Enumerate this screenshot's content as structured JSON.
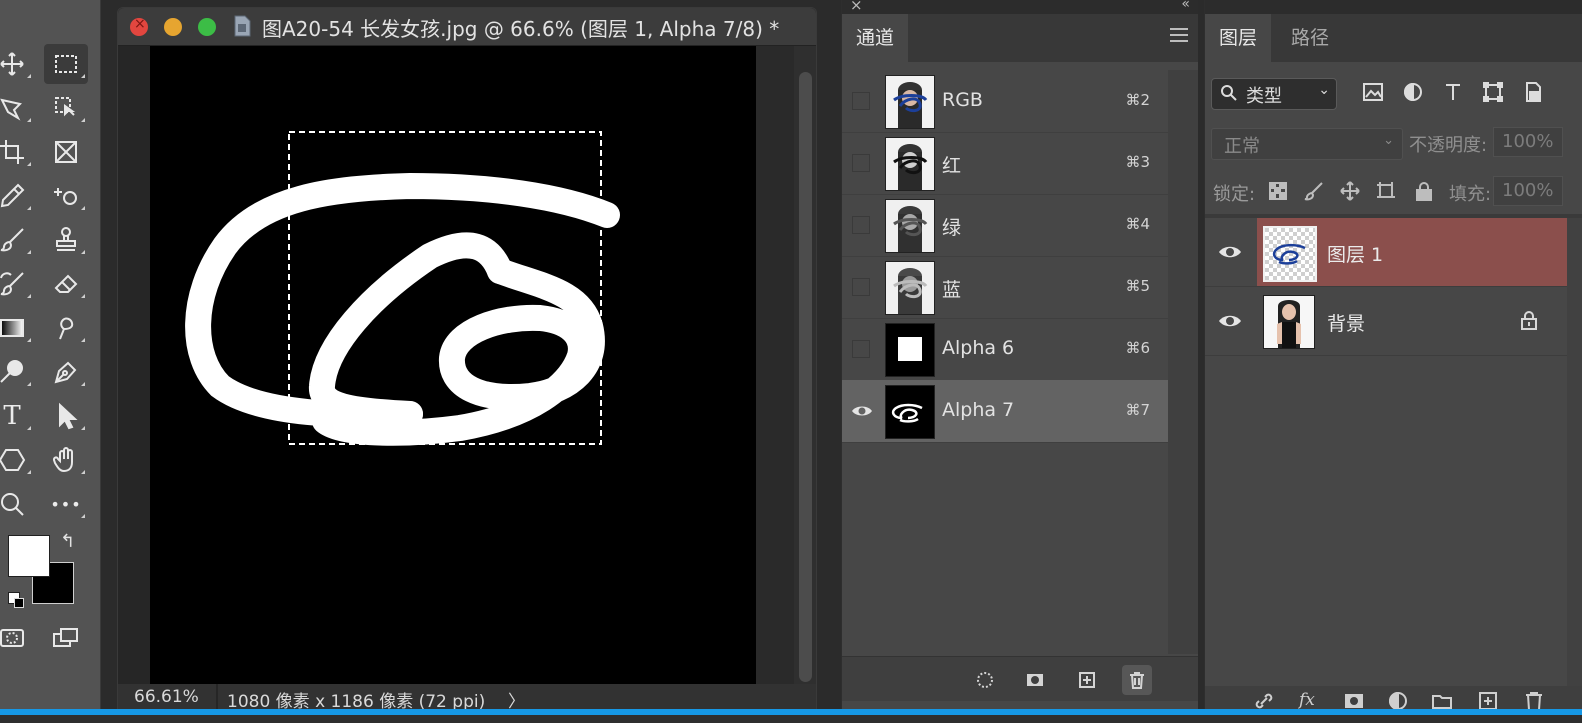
{
  "document": {
    "title": "图A20-54 长发女孩.jpg @ 66.6% (图层 1, Alpha 7/8) *",
    "zoom": "66.61%",
    "info": "1080 像素 x 1186 像素 (72 ppi)",
    "status_arrow": "〉"
  },
  "toolbar": {
    "tools": [
      "move-tool",
      "marquee-tool",
      "lasso-tool",
      "object-select-tool",
      "crop-tool",
      "frame-tool",
      "eyedropper-tool",
      "spot-heal-tool",
      "brush-tool",
      "stamp-tool",
      "history-brush-tool",
      "eraser-tool",
      "gradient-tool",
      "smudge-tool",
      "dodge-tool",
      "pen-tool",
      "type-tool",
      "path-select-tool",
      "shape-tool",
      "hand-tool",
      "zoom-tool",
      "more-tools"
    ],
    "type_glyph": "T",
    "more_glyph": "•••",
    "swap_glyph": "↰",
    "foreground_color": "#ffffff",
    "background_color": "#000000"
  },
  "channels_panel": {
    "tab_label": "通道",
    "close_glyph": "×",
    "collapse_glyph": "«",
    "channels": [
      {
        "name": "RGB",
        "shortcut": "⌘2",
        "visible": false
      },
      {
        "name": "红",
        "shortcut": "⌘3",
        "visible": false
      },
      {
        "name": "绿",
        "shortcut": "⌘4",
        "visible": false
      },
      {
        "name": "蓝",
        "shortcut": "⌘5",
        "visible": false
      },
      {
        "name": "Alpha 6",
        "shortcut": "⌘6",
        "visible": false
      },
      {
        "name": "Alpha 7",
        "shortcut": "⌘7",
        "visible": true,
        "selected": true
      }
    ],
    "bottom_buttons": [
      "load-selection-icon",
      "save-selection-icon",
      "new-channel-icon",
      "delete-channel-icon"
    ]
  },
  "layers_panel": {
    "tabs": [
      "图层",
      "路径"
    ],
    "filter_label": "类型",
    "filter_chevron": "⌄",
    "blend_mode": "正常",
    "blend_chevron": "⌄",
    "opacity_label": "不透明度:",
    "opacity_value": "100%",
    "lock_label": "锁定:",
    "fill_label": "填充:",
    "fill_value": "100%",
    "layers": [
      {
        "name": "图层 1",
        "selected": true,
        "locked": false
      },
      {
        "name": "背景",
        "selected": false,
        "locked": true
      }
    ],
    "bottom_icons": [
      "link-icon",
      "fx-icon",
      "mask-icon",
      "adjustment-icon",
      "group-icon",
      "new-layer-icon",
      "trash-icon"
    ],
    "fx_text": "fx"
  },
  "colors": {
    "selected_layer": "#8b4f4c",
    "progress_bar": "#1698e6"
  }
}
